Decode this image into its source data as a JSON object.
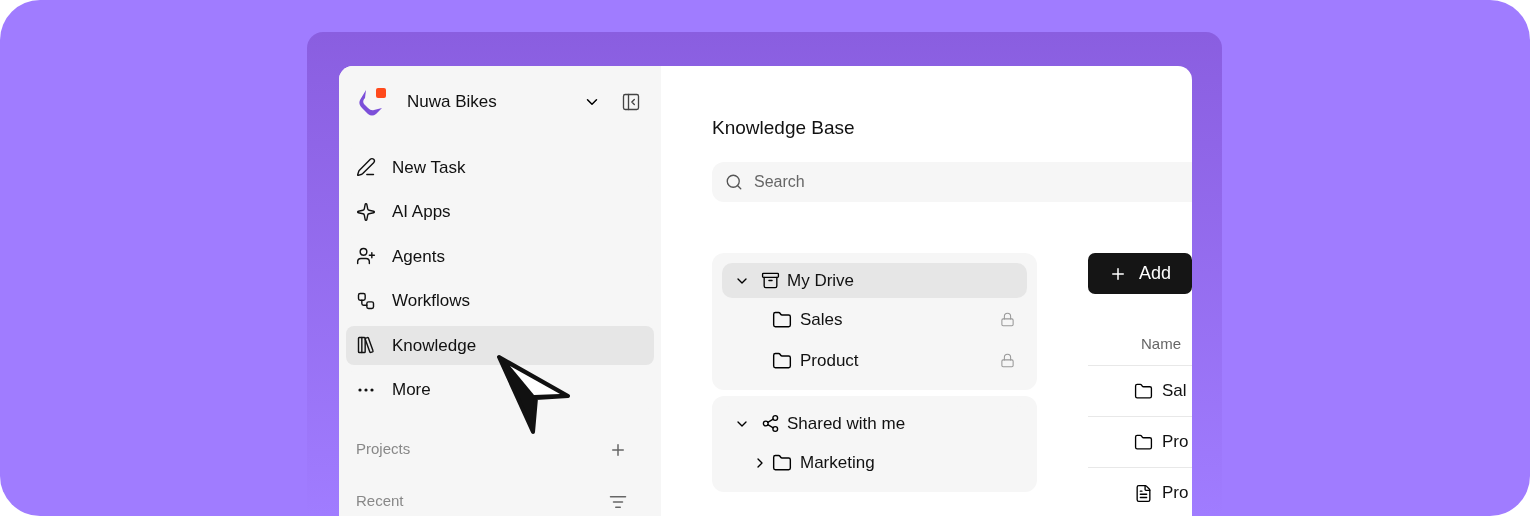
{
  "workspace": {
    "name": "Nuwa Bikes"
  },
  "nav": [
    {
      "label": "New Task",
      "selected": false
    },
    {
      "label": "AI Apps",
      "selected": false
    },
    {
      "label": "Agents",
      "selected": false
    },
    {
      "label": "Workflows",
      "selected": false
    },
    {
      "label": "Knowledge",
      "selected": true
    },
    {
      "label": "More",
      "selected": false
    }
  ],
  "sections": [
    {
      "label": "Projects"
    },
    {
      "label": "Recent"
    }
  ],
  "main": {
    "title": "Knowledge Base",
    "search": {
      "placeholder": "Search"
    },
    "add_button": "Add"
  },
  "tree": [
    {
      "label": "My Drive",
      "expanded": true,
      "selected": true,
      "children": [
        {
          "label": "Sales",
          "locked": true
        },
        {
          "label": "Product",
          "locked": true
        }
      ]
    },
    {
      "label": "Shared with me",
      "expanded": true,
      "selected": false,
      "children": [
        {
          "label": "Marketing",
          "locked": false,
          "expanded": false
        }
      ]
    }
  ],
  "table": {
    "columns": [
      "Name"
    ],
    "rows": [
      {
        "kind": "folder",
        "name": "Sal"
      },
      {
        "kind": "folder",
        "name": "Pro"
      },
      {
        "kind": "file",
        "name": "Pro"
      }
    ]
  }
}
